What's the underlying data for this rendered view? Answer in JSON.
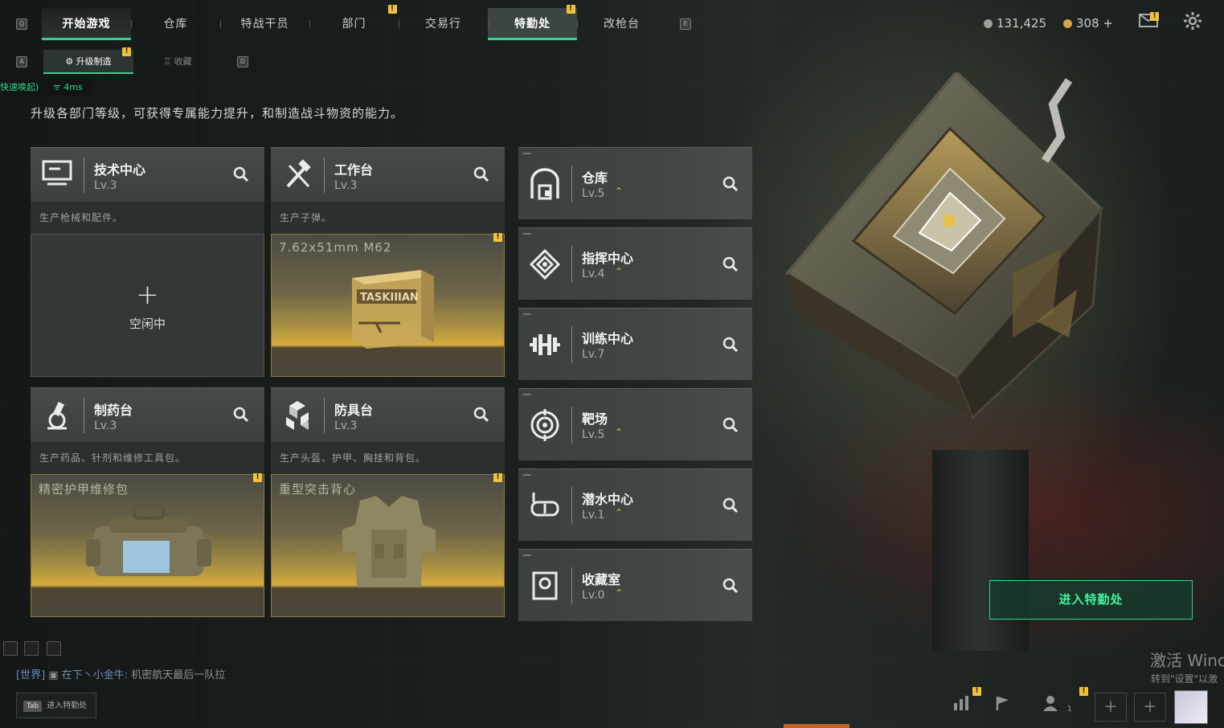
{
  "topbar": {
    "left_key": "Q",
    "right_key": "E",
    "tabs": [
      {
        "label": "开始游戏"
      },
      {
        "label": "仓库"
      },
      {
        "label": "特战干员"
      },
      {
        "label": "部门"
      },
      {
        "label": "交易行"
      },
      {
        "label": "特勤处"
      },
      {
        "label": "改枪台"
      }
    ],
    "currency_1": "131,425",
    "currency_2": "308 +",
    "badge": "!"
  },
  "subnav": {
    "left_key": "A",
    "right_key": "D",
    "tabs": [
      {
        "label": "升级制造"
      },
      {
        "label": "收藏"
      }
    ]
  },
  "network": {
    "prefix": "快速唤起)",
    "ping": "4ms"
  },
  "description": "升级各部门等级，可获得专属能力提升，和制造战斗物资的能力。",
  "stations": [
    {
      "name": "技术中心",
      "level": "Lv.3",
      "desc": "生产枪械和配件。",
      "status": "空闲中",
      "plus": "+"
    },
    {
      "name": "工作台",
      "level": "Lv.3",
      "desc": "生产子弹。",
      "product": "7.62x51mm M62"
    },
    {
      "name": "制药台",
      "level": "Lv.3",
      "desc": "生产药品、针剂和维修工具包。",
      "product": "精密护甲维修包"
    },
    {
      "name": "防具台",
      "level": "Lv.3",
      "desc": "生产头盔、护甲、胸挂和背包。",
      "product": "重型突击背心"
    }
  ],
  "ammo_box_text": "TASKIIIAN",
  "departments": [
    {
      "name": "仓库",
      "level": "Lv.5"
    },
    {
      "name": "指挥中心",
      "level": "Lv.4"
    },
    {
      "name": "训练中心",
      "level": "Lv.7"
    },
    {
      "name": "靶场",
      "level": "Lv.5"
    },
    {
      "name": "潜水中心",
      "level": "Lv.1"
    },
    {
      "name": "收藏室",
      "level": "Lv.0"
    }
  ],
  "enter_button": "进入特勤处",
  "chat": {
    "channel": "[世界]",
    "user": "在下丶小金牛:",
    "message": "机密航天最后一队拉"
  },
  "tab_hint": {
    "key": "Tab",
    "label": "进入特勤处"
  },
  "watermark": {
    "line1": "激活 Winc",
    "line2": "转到\"设置\"以激"
  },
  "friends_count": "1",
  "colors": {
    "accent_green": "#2fd58a",
    "badge_yellow": "#f0c23a",
    "gold": "#d7ac3c"
  }
}
